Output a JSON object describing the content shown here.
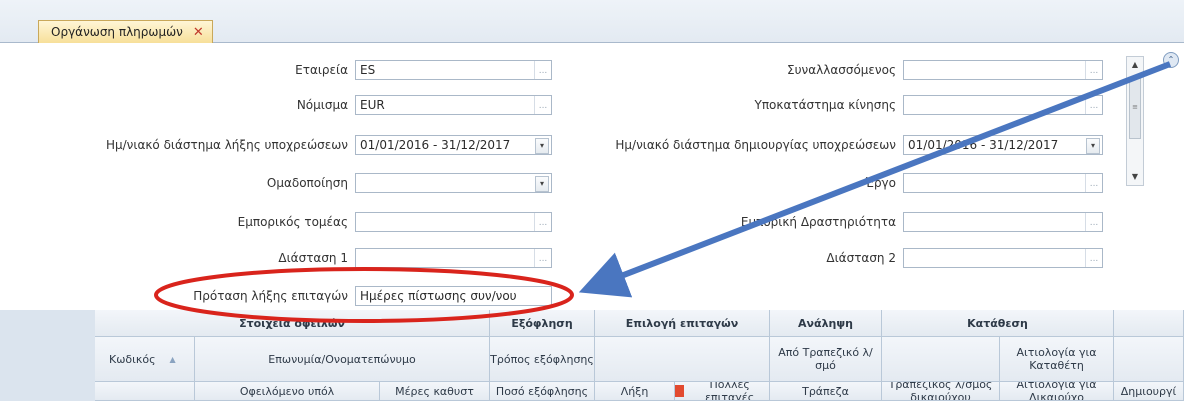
{
  "tab": {
    "title": "Οργάνωση πληρωμών",
    "close": "✕"
  },
  "form": {
    "company": {
      "label": "Εταιρεία",
      "value": "ES"
    },
    "currency": {
      "label": "Νόμισμα",
      "value": "EUR"
    },
    "due_range": {
      "label": "Ημ/νιακό διάστημα λήξης υποχρεώσεων",
      "value": "01/01/2016 - 31/12/2017"
    },
    "grouping": {
      "label": "Ομαδοποίηση",
      "value": ""
    },
    "sector": {
      "label": "Εμπορικός τομέας",
      "value": ""
    },
    "dimension1": {
      "label": "Διάσταση 1",
      "value": ""
    },
    "cheque_proposal": {
      "label": "Πρόταση λήξης επιταγών",
      "value": "Ημέρες πίστωσης συν/νου"
    },
    "counterparty": {
      "label": "Συναλλασσόμενος",
      "value": ""
    },
    "branch": {
      "label": "Υποκατάστημα κίνησης",
      "value": ""
    },
    "created_range": {
      "label": "Ημ/νιακό διάστημα δημιουργίας υποχρεώσεων",
      "value": "01/01/2016 - 31/12/2017"
    },
    "project": {
      "label": "Έργο",
      "value": ""
    },
    "activity": {
      "label": "Εμπορική Δραστηριότητα",
      "value": ""
    },
    "dimension2": {
      "label": "Διάσταση 2",
      "value": ""
    },
    "ellipsis": "...",
    "dropdown": "▾"
  },
  "scrollbar": {
    "up": "▲",
    "down": "▼",
    "grip": "≡"
  },
  "collapse_glyph": "⌃",
  "grid": {
    "bands": [
      "Στοιχεία οφειλών",
      "Εξόφληση",
      "Επιλογή επιταγών",
      "Ανάληψη",
      "Κατάθεση"
    ],
    "row2": {
      "code": "Κωδικός",
      "name": "Επωνυμία/Ονοματεπώνυμο",
      "pay_method": "Τρόπος εξόφλησης",
      "from_bank": "Από Τραπεζικό λ/σμό",
      "depositor_reason": "Αιτιολογία για Καταθέτη"
    },
    "row3": {
      "balance": "Οφειλόμενο υπόλ",
      "days": "Μέρες καθυστ",
      "amount": "Ποσό εξόφλησης",
      "none": "Λήξη",
      "multiple": "Πολλές επιταγές",
      "bank": "Τράπεζα",
      "bank_account": "Τραπεζικός λ/σμός δικαιούχου",
      "reason": "Αιτιολογία για Δικαιούχο",
      "create": "Δημιουργί"
    }
  },
  "annotation": {
    "ellipse_color": "#d9241c",
    "arrow_color": "#4a76c0"
  }
}
